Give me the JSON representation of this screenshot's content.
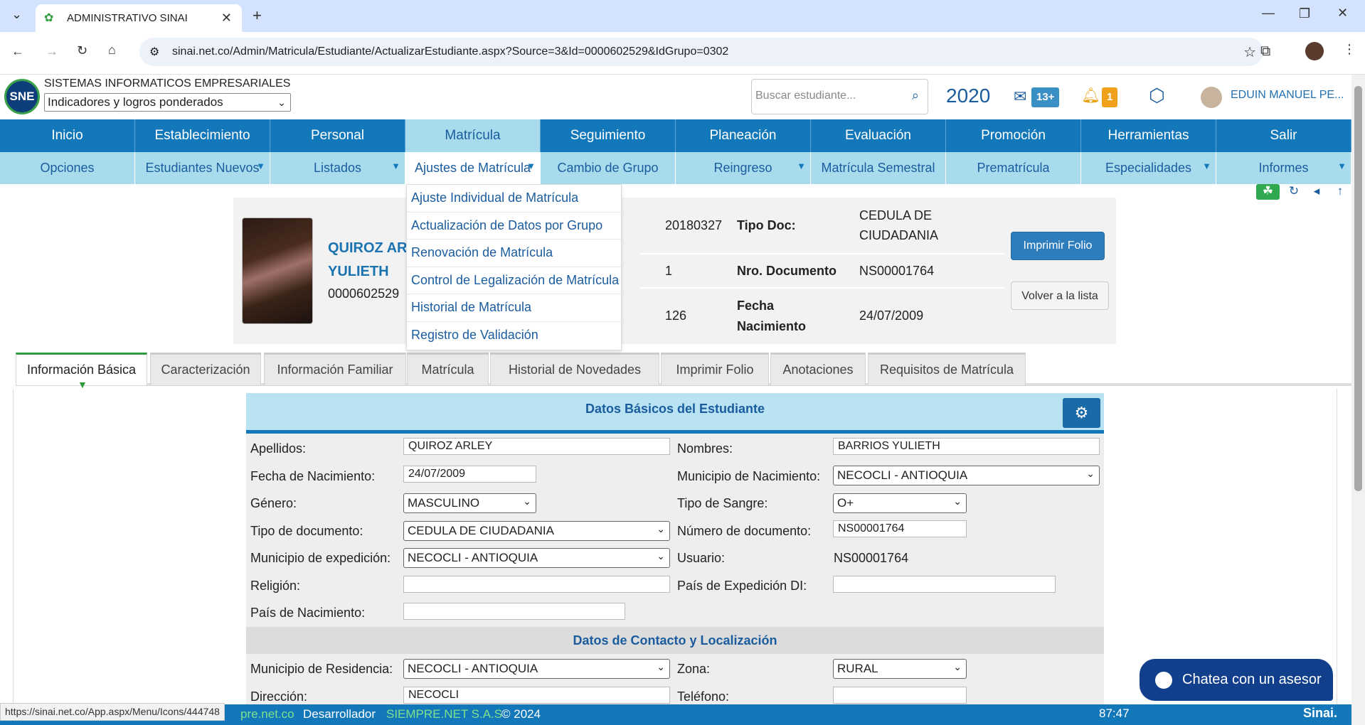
{
  "browser": {
    "tab_title": "ADMINISTRATIVO SINAI",
    "url": "sinai.net.co/Admin/Matricula/Estudiante/ActualizarEstudiante.aspx?Source=3&Id=0000602529&IdGrupo=0302",
    "status_url": "https://sinai.net.co/App.aspx/Menu/Icons/444748"
  },
  "header": {
    "logo_text": "SNE",
    "system_name": "SISTEMAS INFORMATICOS EMPRESARIALES",
    "system_select": "Indicadores y logros ponderados",
    "search_placeholder": "Buscar estudiante...",
    "year": "2020",
    "mail_count": "13+",
    "notif_count": "1",
    "user_name": "EDUIN MANUEL PE..."
  },
  "menu_main": [
    "Inicio",
    "Establecimiento",
    "Personal",
    "Matrícula",
    "Seguimiento",
    "Planeación",
    "Evaluación",
    "Promoción",
    "Herramientas",
    "Salir"
  ],
  "menu_sub": [
    "Opciones",
    "Estudiantes Nuevos",
    "Listados",
    "Ajustes de Matrícula",
    "Cambio de Grupo",
    "Reingreso",
    "Matrícula Semestral",
    "Prematrícula",
    "Especialidades",
    "Informes"
  ],
  "dropdown": [
    "Ajuste Individual de Matrícula",
    "Actualización de Datos por Grupo",
    "Renovación de Matrícula",
    "Control de Legalización de Matrícula",
    "Historial de Matrícula",
    "Registro de Validación"
  ],
  "student": {
    "name_line1": "QUIROZ AR",
    "name_line2": "YULIETH",
    "code": "0000602529",
    "v1": "20180327",
    "v2": "1",
    "v3": "126",
    "tipo_doc_label": "Tipo Doc:",
    "tipo_doc_value_1": "CEDULA DE",
    "tipo_doc_value_2": "CIUDADANIA",
    "nro_doc_label": "Nro. Documento",
    "nro_doc_value": "NS00001764",
    "fecha_label_1": "Fecha",
    "fecha_label_2": "Nacimiento",
    "fecha_value": "24/07/2009",
    "btn_print": "Imprimir Folio",
    "btn_back": "Volver a la lista"
  },
  "tabs": [
    "Información Básica",
    "Caracterización",
    "Información Familiar",
    "Matrícula",
    "Historial de Novedades",
    "Imprimir Folio",
    "Anotaciones",
    "Requisitos de Matrícula"
  ],
  "form": {
    "title": "Datos Básicos del Estudiante",
    "apellidos_label": "Apellidos:",
    "apellidos": "QUIROZ ARLEY",
    "nombres_label": "Nombres:",
    "nombres": "BARRIOS YULIETH",
    "fecha_label": "Fecha de Nacimiento:",
    "fecha": "24/07/2009",
    "mun_nac_label": "Municipio de Nacimiento:",
    "mun_nac": "NECOCLI - ANTIOQUIA",
    "genero_label": "Género:",
    "genero": "MASCULINO",
    "sangre_label": "Tipo de Sangre:",
    "sangre": "O+",
    "tipodoc_label": "Tipo de documento:",
    "tipodoc": "CEDULA DE CIUDADANIA",
    "numdoc_label": "Número de documento:",
    "numdoc": "NS00001764",
    "mun_exp_label": "Municipio de expedición:",
    "mun_exp": "NECOCLI - ANTIOQUIA",
    "usuario_label": "Usuario:",
    "usuario": "NS00001764",
    "religion_label": "Religión:",
    "religion": "",
    "pais_exp_label": "País de Expedición DI:",
    "pais_exp": "",
    "pais_nac_label": "País de Nacimiento:",
    "pais_nac": "",
    "contact_title": "Datos de Contacto y Localización",
    "mun_res_label": "Municipio de Residencia:",
    "mun_res": "NECOCLI - ANTIOQUIA",
    "zona_label": "Zona:",
    "zona": "RURAL",
    "direccion_label": "Dirección:",
    "direccion": "NECOCLI",
    "telefono_label": "Teléfono:",
    "telefono": ""
  },
  "footer": {
    "site": "pre.net.co",
    "dev_label": "Desarrollador",
    "dev_name": "SIEMPRE.NET S.A.S",
    "copyright": "© 2024",
    "timer": "87:47",
    "brand": "Sinai."
  },
  "chat": {
    "label": "Chatea con un asesor"
  }
}
